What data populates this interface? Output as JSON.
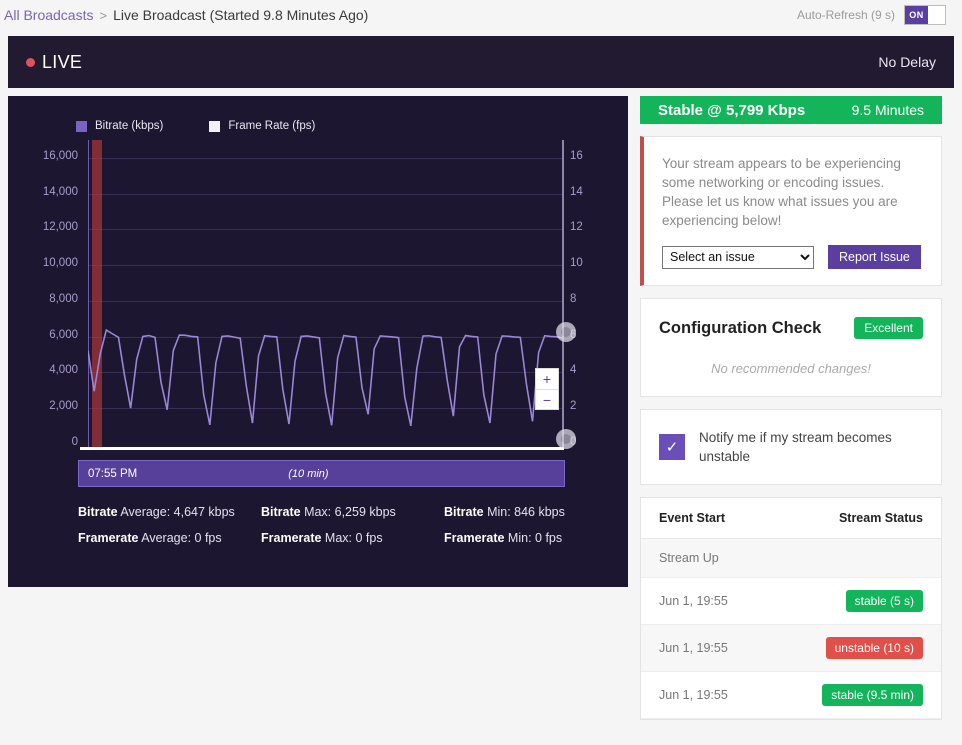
{
  "breadcrumb": {
    "root_label": "All Broadcasts",
    "separator": ">",
    "current_label": "Live Broadcast (Started 9.8 Minutes Ago)"
  },
  "auto_refresh": {
    "label": "Auto-Refresh (9 s)",
    "state_label": "ON"
  },
  "live_banner": {
    "status_label": "LIVE",
    "delay_label": "No Delay",
    "dot_color": "#e05260",
    "background": "#211a31"
  },
  "chart_panel": {
    "timeline": {
      "time_label": "07:55 PM",
      "duration_label": "(10 min)"
    },
    "zoom_in_label": "+",
    "zoom_out_label": "−",
    "stats": [
      [
        {
          "bold": "Bitrate",
          "rest": " Average: 4,647 kbps"
        },
        {
          "bold": "Bitrate",
          "rest": " Max: 6,259 kbps"
        },
        {
          "bold": "Bitrate",
          "rest": " Min: 846 kbps"
        }
      ],
      [
        {
          "bold": "Framerate",
          "rest": " Average: 0 fps"
        },
        {
          "bold": "Framerate",
          "rest": " Max: 0 fps"
        },
        {
          "bold": "Framerate",
          "rest": " Min: 0 fps"
        }
      ]
    ]
  },
  "chart_data": {
    "type": "line",
    "title": "",
    "xlabel": "",
    "ylabel": "Bitrate (kbps)",
    "y2label": "Frame Rate (fps)",
    "ylim": [
      0,
      17000
    ],
    "y2lim": [
      0,
      17
    ],
    "yticks": [
      0,
      2000,
      4000,
      6000,
      8000,
      10000,
      12000,
      14000,
      16000
    ],
    "ytick_labels": [
      "0",
      "2,000",
      "4,000",
      "6,000",
      "8,000",
      "10,000",
      "12,000",
      "14,000",
      "16,000"
    ],
    "y2ticks": [
      0,
      2,
      4,
      6,
      8,
      10,
      12,
      14,
      16
    ],
    "y2tick_labels": [
      "0",
      "2",
      "4",
      "6",
      "8",
      "10",
      "12",
      "14",
      "16"
    ],
    "grid": true,
    "legend_position": "top-left",
    "legend": [
      {
        "name": "Bitrate (kbps)",
        "color": "#7a63c4"
      },
      {
        "name": "Frame Rate (fps)",
        "color": "#f2f0f6"
      }
    ],
    "annotations": [
      {
        "type": "vertical-band",
        "label": "unstable period",
        "color": "#be3c3c",
        "x_start": 0.5,
        "x_end": 2.5
      }
    ],
    "series": [
      {
        "name": "Bitrate (kbps)",
        "color": "#9b86d8",
        "axis": "left",
        "values": [
          5100,
          2800,
          4900,
          6259,
          6050,
          5850,
          3700,
          1850,
          4600,
          5900,
          5950,
          5850,
          3300,
          1750,
          5100,
          5980,
          5960,
          5900,
          5870,
          2600,
          900,
          4400,
          5900,
          5930,
          5860,
          5800,
          3100,
          1000,
          4800,
          5940,
          5900,
          5880,
          2900,
          950,
          4500,
          5900,
          5930,
          5870,
          5820,
          2700,
          880,
          4700,
          5950,
          5900,
          5860,
          3000,
          1500,
          5200,
          5930,
          5900,
          5870,
          5830,
          2500,
          846,
          4100,
          5920,
          5940,
          5880,
          5840,
          3400,
          1400,
          5300,
          5950,
          5900,
          5870,
          2600,
          1000,
          4900,
          5930,
          5910,
          5870,
          5850,
          3200,
          1100,
          5000,
          5940,
          5900,
          5880,
          5799
        ]
      },
      {
        "name": "Frame Rate (fps)",
        "color": "#ffffff",
        "axis": "right",
        "values": [
          0,
          0,
          0,
          0,
          0,
          0,
          0,
          0,
          0,
          0,
          0,
          0,
          0,
          0,
          0,
          0,
          0,
          0,
          0,
          0,
          0,
          0,
          0,
          0,
          0,
          0,
          0,
          0,
          0,
          0,
          0,
          0,
          0,
          0,
          0,
          0,
          0,
          0,
          0,
          0,
          0,
          0,
          0,
          0,
          0,
          0,
          0,
          0,
          0,
          0,
          0,
          0,
          0,
          0,
          0,
          0,
          0,
          0,
          0,
          0,
          0,
          0,
          0,
          0,
          0,
          0,
          0,
          0,
          0,
          0,
          0,
          0,
          0,
          0,
          0,
          0,
          0,
          0,
          0
        ]
      }
    ]
  },
  "stable_bar": {
    "title": "Stable @ 5,799 Kbps",
    "duration": "9.5 Minutes",
    "color": "#14b45a"
  },
  "alert_card": {
    "message": "Your stream appears to be experiencing some networking or encoding issues. Please let us know what issues you are experiencing below!",
    "select_value": "Select an issue",
    "report_button": "Report Issue",
    "accent_color": "#c0504a"
  },
  "config_check": {
    "title": "Configuration Check",
    "badge": "Excellent",
    "note": "No recommended changes!"
  },
  "notify": {
    "label": "Notify me if my stream becomes unstable",
    "checked": true,
    "check_glyph": "✓"
  },
  "events": {
    "columns": [
      "Event Start",
      "Stream Status"
    ],
    "rows": [
      {
        "start": "Stream Up",
        "status": "",
        "status_kind": "none"
      },
      {
        "start": "Jun 1, 19:55",
        "status": "stable (5 s)",
        "status_kind": "stable"
      },
      {
        "start": "Jun 1, 19:55",
        "status": "unstable (10 s)",
        "status_kind": "unstable"
      },
      {
        "start": "Jun 1, 19:55",
        "status": "stable (9.5 min)",
        "status_kind": "stable"
      }
    ]
  }
}
